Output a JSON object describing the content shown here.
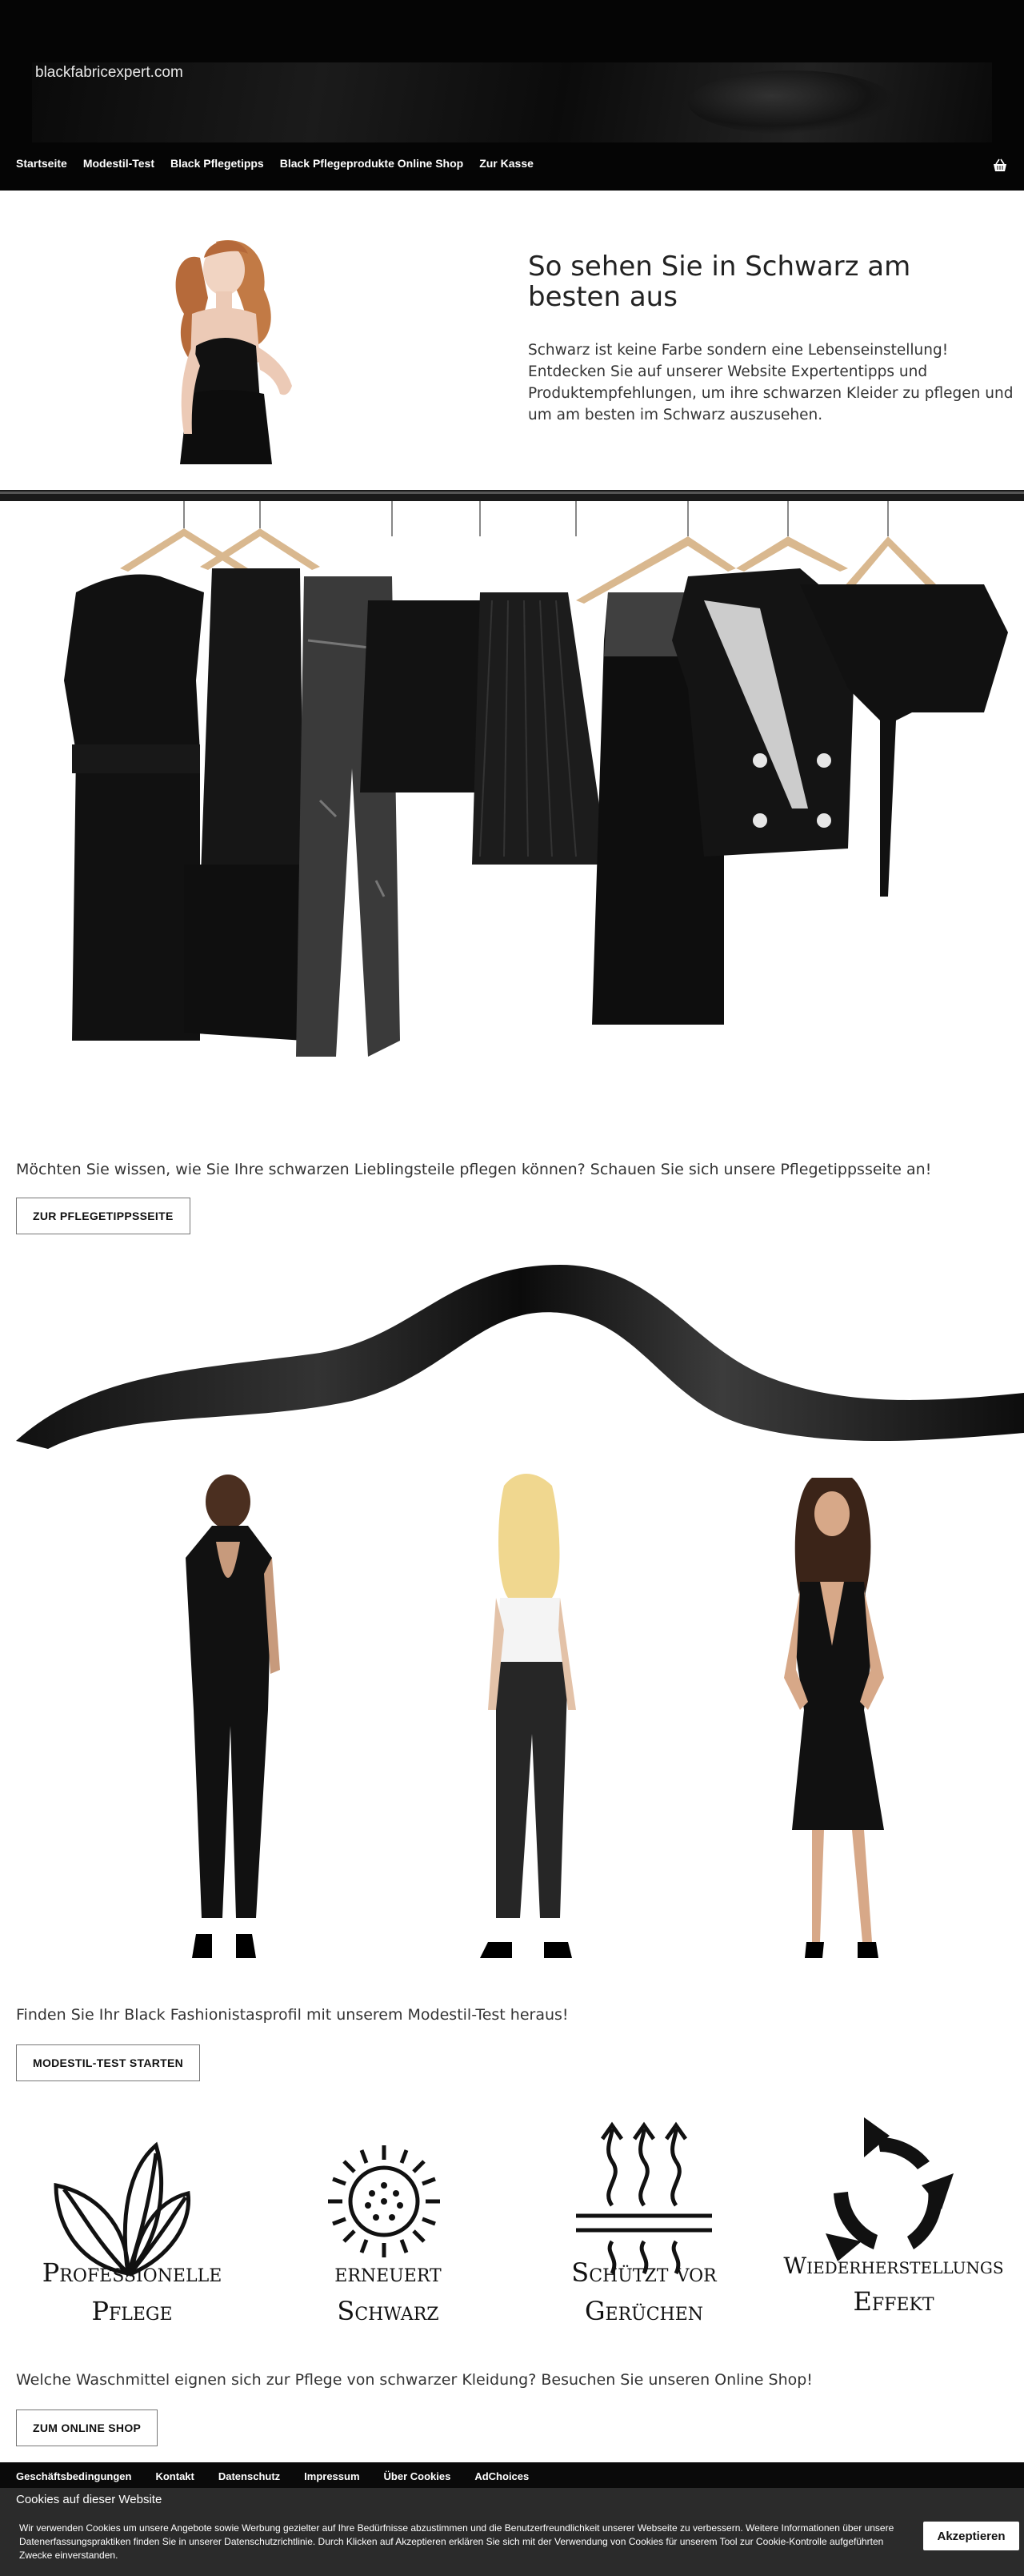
{
  "header": {
    "site_title": "blackfabricexpert.com",
    "nav": [
      "Startseite",
      "Modestil-Test",
      "Black Pflegetipps",
      "Black Pflegeprodukte Online Shop",
      "Zur Kasse"
    ],
    "cart_icon": "basket-icon"
  },
  "hero": {
    "title": "So sehen Sie in Schwarz am besten aus",
    "text": "Schwarz ist keine Farbe sondern eine Lebenseinstellung! Entdecken Sie auf unserer Website Expertentipps und Produktempfehlungen, um ihre schwarzen Kleider zu pflegen und um am besten im Schwarz auszusehen."
  },
  "care": {
    "text": "Möchten Sie wissen, wie Sie Ihre schwarzen Lieblingsteile pflegen können? Schauen Sie sich unsere Pflegetippsseite an!",
    "button": "ZUR PFLEGETIPPSSEITE"
  },
  "quiz": {
    "text": "Finden Sie Ihr Black Fashionistasprofil mit unserem Modestil-Test heraus!",
    "button": "MODESTIL-TEST STARTEN"
  },
  "features": [
    {
      "line1": "Professionelle",
      "line2": "Pflege",
      "icon": "leaves-icon"
    },
    {
      "line1": "erneuert",
      "line2": "Schwarz",
      "icon": "sun-icon"
    },
    {
      "line1": "Schützt vor",
      "line2": "Gerüchen",
      "icon": "heat-waves-icon"
    },
    {
      "line1": "Wiederherstellungs",
      "line2": "Effekt",
      "icon": "recycle-arrows-icon"
    }
  ],
  "shop": {
    "text": "Welche Waschmittel eignen sich zur Pflege von schwarzer Kleidung? Besuchen Sie unseren Online Shop!",
    "button": "ZUM ONLINE SHOP"
  },
  "footer": {
    "links": [
      "Geschäftsbedingungen",
      "Kontakt",
      "Datenschutz",
      "Impressum",
      "Über Cookies",
      "AdChoices"
    ]
  },
  "cookie": {
    "title": "Cookies auf dieser Website",
    "text": "Wir verwenden Cookies um unsere Angebote sowie Werbung gezielter auf Ihre Bedürfnisse abzustimmen und die Benutzerfreundlichkeit unserer Webseite zu verbessern. Weitere Informationen über unsere Datenerfassungspraktiken finden Sie in unserer Datenschutzrichtlinie. Durch Klicken auf Akzeptieren erklären Sie sich mit der Verwendung von Cookies für unserem Tool zur Cookie-Kontrolle aufgeführten Zwecke einverstanden.",
    "accept": "Akzeptieren"
  }
}
